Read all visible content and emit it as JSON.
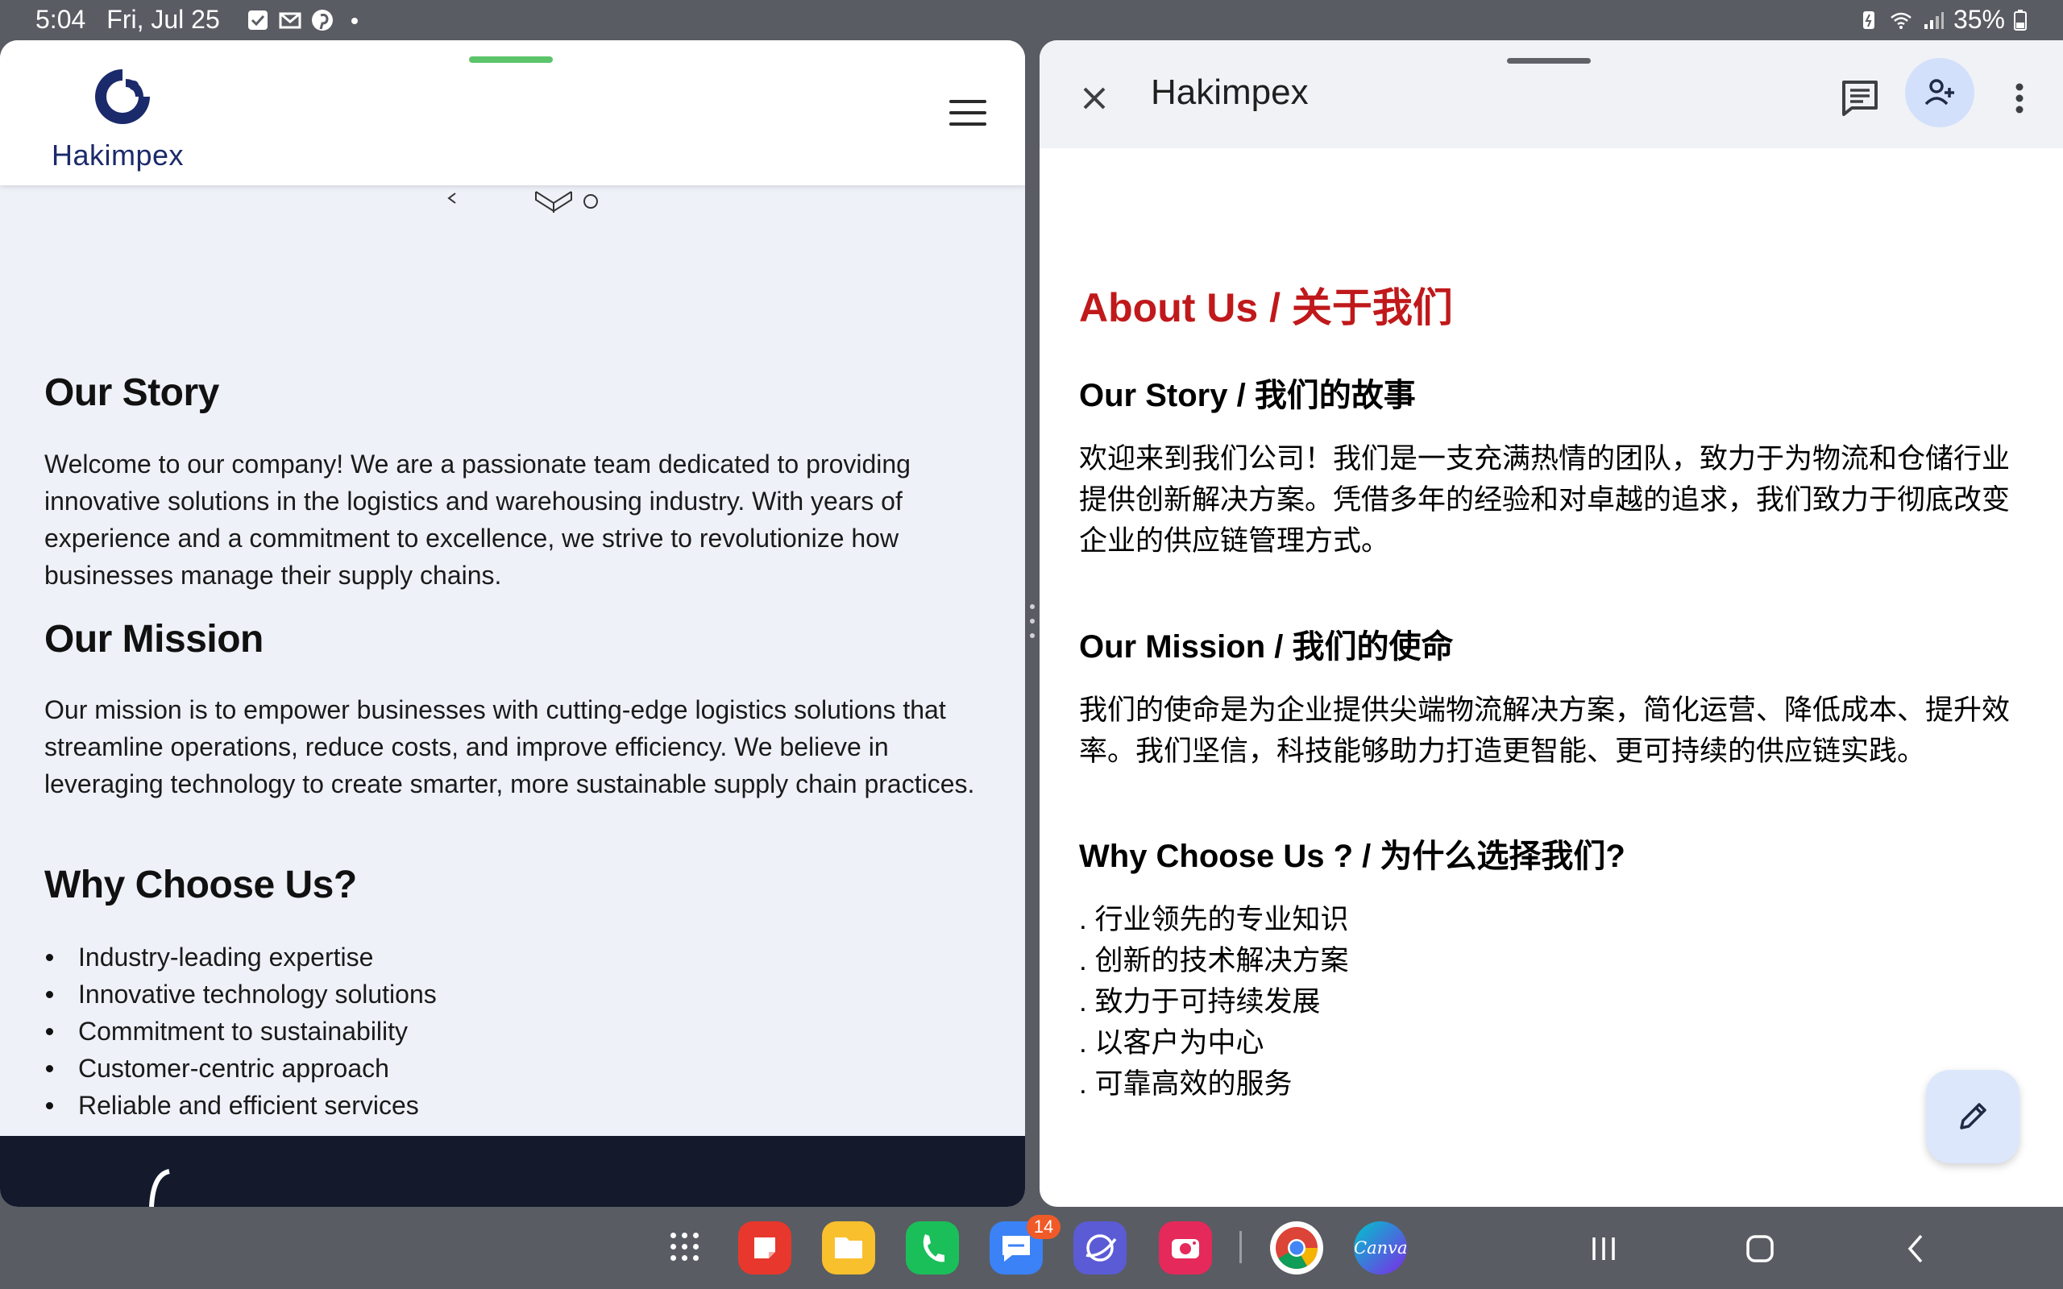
{
  "status_bar": {
    "time": "5:04",
    "date": "Fri, Jul 25",
    "battery": "35%"
  },
  "website": {
    "logo_text": "Hakimpex",
    "sections": {
      "story_heading": "Our Story",
      "story_text": "Welcome to our company! We are a passionate team dedicated to providing innovative solutions in the logistics and warehousing industry. With years of experience and a commitment to excellence, we strive to revolutionize how businesses manage their supply chains.",
      "mission_heading": "Our Mission",
      "mission_text": "Our mission is to empower businesses with cutting-edge logistics solutions that streamline operations, reduce costs, and improve efficiency. We believe in leveraging technology to create smarter, more sustainable supply chain practices.",
      "why_heading": "Why Choose Us?",
      "why_items": [
        "Industry-leading expertise",
        "Innovative technology solutions",
        "Commitment to sustainability",
        "Customer-centric approach",
        "Reliable and efficient services"
      ]
    }
  },
  "document": {
    "title": "Hakimpex",
    "doc_heading": "About Us / 关于我们",
    "story_heading": "Our Story / 我们的故事",
    "story_text": "欢迎来到我们公司！我们是一支充满热情的团队，致力于为物流和仓储行业提供创新解决方案。凭借多年的经验和对卓越的追求，我们致力于彻底改变企业的供应链管理方式。",
    "mission_heading": "Our Mission / 我们的使命",
    "mission_text": "我们的使命是为企业提供尖端物流解决方案，简化运营、降低成本、提升效率。我们坚信，科技能够助力打造更智能、更可持续的供应链实践。",
    "why_heading": "Why Choose Us ? / 为什么选择我们?",
    "why_items": [
      ". 行业领先的专业知识",
      ". 创新的技术解决方案",
      ". 致力于可持续发展",
      ". 以客户为中心",
      ". 可靠高效的服务"
    ]
  },
  "taskbar": {
    "messages_badge": "14",
    "canva_label": "Canva"
  },
  "colors": {
    "doc_heading": "#c0191b",
    "site_footer": "#141a2c",
    "share_button_bg": "#d3e0fb",
    "logo_navy": "#1b2a6b"
  }
}
